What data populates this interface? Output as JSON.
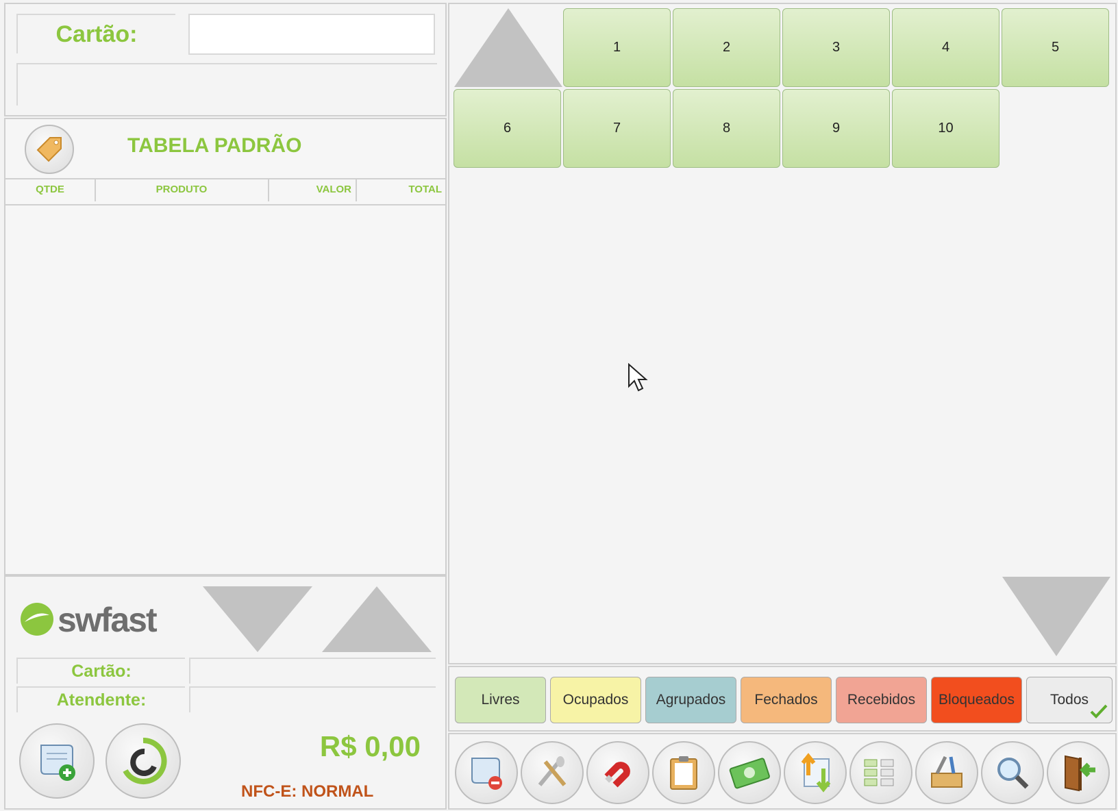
{
  "card_section": {
    "label": "Cartão:",
    "value": "",
    "subvalue": ""
  },
  "table": {
    "name": "TABELA PADRÃO",
    "price_tag_icon": "price-tag-icon"
  },
  "columns": [
    "QTDE",
    "PRODUTO",
    "VALOR",
    "TOTAL"
  ],
  "footer": {
    "brand": "swfast",
    "card_label": "Cartão:",
    "card_value": "",
    "attendant_label": "Atendente:",
    "attendant_value": "",
    "total": "R$ 0,00",
    "nfce_status": "NFC-E: NORMAL"
  },
  "tables": [
    "1",
    "2",
    "3",
    "4",
    "5",
    "6",
    "7",
    "8",
    "9",
    "10"
  ],
  "filters": [
    {
      "label": "Livres",
      "color": "#d3e8b8"
    },
    {
      "label": "Ocupados",
      "color": "#f7f3a6"
    },
    {
      "label": "Agrupados",
      "color": "#a6cdd0"
    },
    {
      "label": "Fechados",
      "color": "#f5b87c"
    },
    {
      "label": "Recebidos",
      "color": "#f1a494"
    },
    {
      "label": "Bloqueados",
      "color": "#f24e1e"
    },
    {
      "label": "Todos",
      "color": "#ececec",
      "selected": true
    }
  ],
  "toolbar_icons": [
    "remove-order-icon",
    "utensils-icon",
    "magnet-icon",
    "clipboard-icon",
    "money-icon",
    "transfer-icon",
    "group-tables-icon",
    "tools-icon",
    "search-icon",
    "exit-door-icon"
  ],
  "colors": {
    "accent_green": "#8cc63f",
    "nfce_orange": "#c0531a"
  }
}
